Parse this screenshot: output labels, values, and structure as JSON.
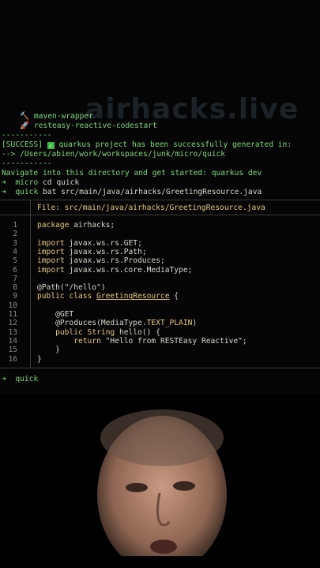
{
  "terminal": {
    "watermark": "airhacks.live",
    "extensions": [
      {
        "icon": "wrench-icon",
        "label": "maven-wrapper"
      },
      {
        "icon": "rocket-icon",
        "label": "resteasy-reactive-codestart"
      }
    ],
    "dashes1": "-----------",
    "success_tag": "[SUCCESS]",
    "success_msg": " quarkus project has been successfully generated in:",
    "path_line": "--> /Users/abien/work/workspaces/junk/micro/quick",
    "dashes2": "-----------",
    "navigate": "Navigate into this directory and get started: quarkus dev",
    "cmd1_dir": "micro",
    "cmd1": "cd quick",
    "cmd2_dir": "quick",
    "cmd2": "bat src/main/java/airhacks/GreetingResource.java",
    "file_header": "File: src/main/java/airhacks/GreetingResource.java",
    "prompt_dir": "quick"
  },
  "code_lines": [
    {
      "n": "1",
      "t": "package airhacks;"
    },
    {
      "n": "2",
      "t": ""
    },
    {
      "n": "3",
      "t": "import javax.ws.rs.GET;"
    },
    {
      "n": "4",
      "t": "import javax.ws.rs.Path;"
    },
    {
      "n": "5",
      "t": "import javax.ws.rs.Produces;"
    },
    {
      "n": "6",
      "t": "import javax.ws.rs.core.MediaType;"
    },
    {
      "n": "7",
      "t": ""
    },
    {
      "n": "8",
      "t": "@Path(\"/hello\")"
    },
    {
      "n": "9",
      "t": "public class GreetingResource {"
    },
    {
      "n": "10",
      "t": ""
    },
    {
      "n": "11",
      "t": "    @GET"
    },
    {
      "n": "12",
      "t": "    @Produces(MediaType.TEXT_PLAIN)"
    },
    {
      "n": "13",
      "t": "    public String hello() {"
    },
    {
      "n": "14",
      "t": "        return \"Hello from RESTEasy Reactive\";"
    },
    {
      "n": "15",
      "t": "    }"
    },
    {
      "n": "16",
      "t": "}"
    }
  ]
}
